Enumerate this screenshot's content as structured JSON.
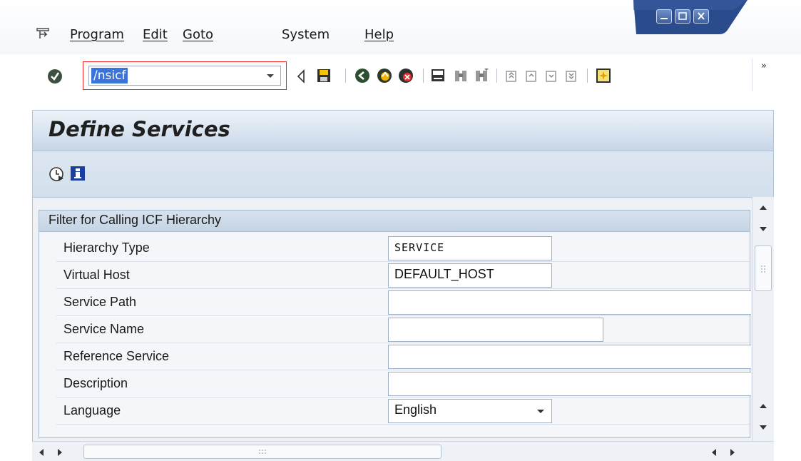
{
  "menu": {
    "items": [
      "Program",
      "Edit",
      "Goto",
      "System",
      "Help"
    ]
  },
  "toolbar": {
    "command_value": "/nsicf",
    "icons": [
      "enter-icon",
      "back-arrow-icon",
      "save-icon",
      "back-icon",
      "exit-icon",
      "cancel-icon",
      "print-icon",
      "find-icon",
      "find-next-icon",
      "first-page-icon",
      "previous-page-icon",
      "next-page-icon",
      "last-page-icon",
      "create-session-icon"
    ],
    "expand_label": "»"
  },
  "screen": {
    "title": "Define Services"
  },
  "app_toolbar": {
    "icons": [
      "execute-icon",
      "info-icon"
    ]
  },
  "group": {
    "header": "Filter for Calling ICF Hierarchy",
    "rows": [
      {
        "label": "Hierarchy Type",
        "value": "SERVICE"
      },
      {
        "label": "Virtual Host",
        "value": "DEFAULT_HOST"
      },
      {
        "label": "Service Path",
        "value": ""
      },
      {
        "label": "Service Name",
        "value": ""
      },
      {
        "label": "Reference Service",
        "value": ""
      },
      {
        "label": "Description",
        "value": ""
      },
      {
        "label": "Language",
        "value": "English"
      }
    ]
  },
  "colors": {
    "selection": "#3a73d9",
    "command_frame": "#ff2020",
    "header_bg": "#c6d6e8"
  }
}
